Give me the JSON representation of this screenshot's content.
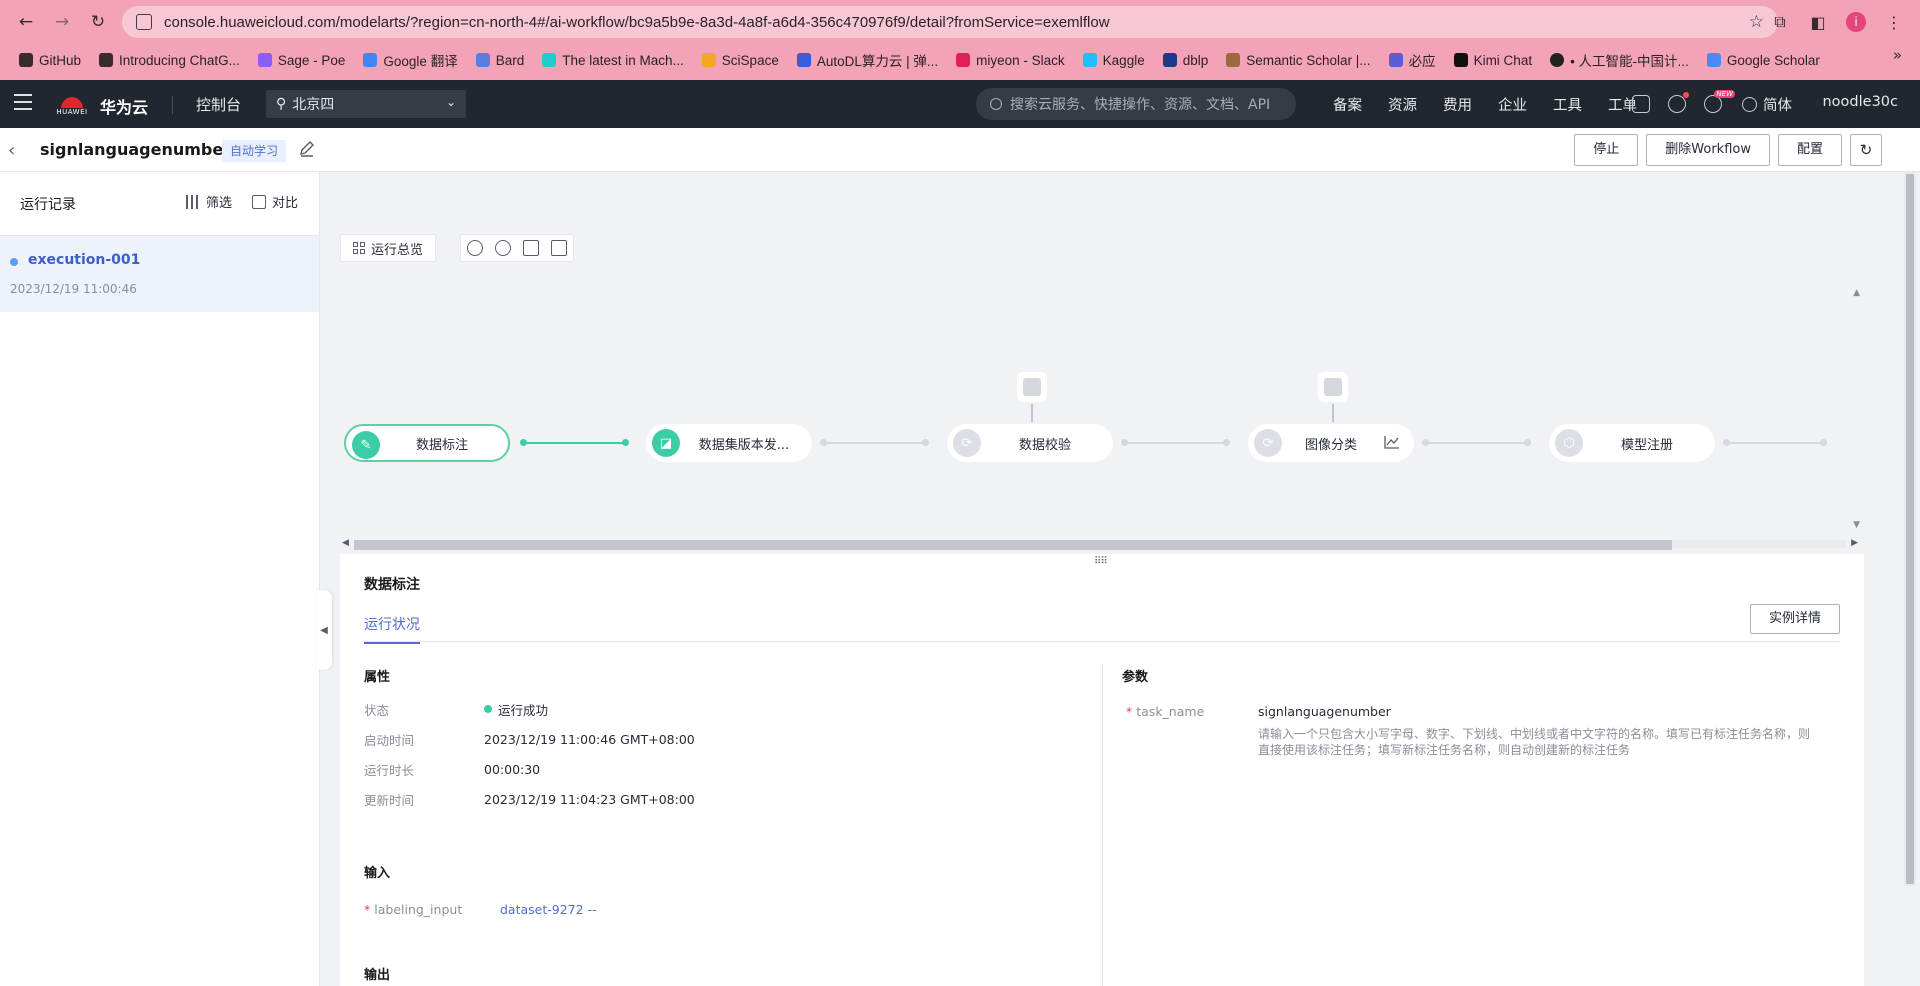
{
  "browser": {
    "url": "console.huaweicloud.com/modelarts/?region=cn-north-4#/ai-workflow/bc9a5b9e-8a3d-4a8f-a6d4-356c470976f9/detail?fromService=exemlflow",
    "profile_initial": "i",
    "bookmarks": [
      "GitHub",
      "Introducing ChatG...",
      "Sage - Poe",
      "Google 翻译",
      "Bard",
      "The latest in Mach...",
      "SciSpace",
      "AutoDL算力云 | 弹...",
      "miyeon - Slack",
      "Kaggle",
      "dblp",
      "Semantic Scholar |...",
      "必应",
      "Kimi Chat",
      "• 人工智能-中国计...",
      "Google Scholar"
    ]
  },
  "topbar": {
    "logo_text": "HUAWEI",
    "brand": "华为云",
    "console": "控制台",
    "region": "北京四",
    "search_placeholder": "搜索云服务、快捷操作、资源、文档、API",
    "links": [
      "备案",
      "资源",
      "费用",
      "企业",
      "工具",
      "工单"
    ],
    "new_badge": "NEW",
    "language": "简体",
    "user": "noodle30c"
  },
  "header": {
    "title": "signlanguagenumber",
    "tag": "自动学习",
    "buttons": {
      "stop": "停止",
      "delete": "删除Workflow",
      "config": "配置"
    }
  },
  "sidebar": {
    "title": "运行记录",
    "filter": "筛选",
    "compare": "对比",
    "runs": [
      {
        "name": "execution-001",
        "time": "2023/12/19 11:00:46"
      }
    ]
  },
  "canvas": {
    "overview": "运行总览",
    "nodes": [
      {
        "label": "数据标注",
        "status": "success"
      },
      {
        "label": "数据集版本发...",
        "status": "success"
      },
      {
        "label": "数据校验",
        "status": "pending"
      },
      {
        "label": "图像分类",
        "status": "pending"
      },
      {
        "label": "模型注册",
        "status": "pending"
      }
    ]
  },
  "panel": {
    "title": "数据标注",
    "tab": "运行状况",
    "detail_button": "实例详情",
    "attributes_title": "属性",
    "attributes": [
      {
        "key": "状态",
        "value": "运行成功"
      },
      {
        "key": "启动时间",
        "value": "2023/12/19 11:00:46 GMT+08:00"
      },
      {
        "key": "运行时长",
        "value": "00:00:30"
      },
      {
        "key": "更新时间",
        "value": "2023/12/19 11:04:23 GMT+08:00"
      }
    ],
    "params_title": "参数",
    "param": {
      "key": "task_name",
      "value": "signlanguagenumber",
      "desc": "请输入一个只包含大小写字母、数字、下划线、中划线或者中文字符的名称。填写已有标注任务名称，则直接使用该标注任务；填写新标注任务名称，则自动创建新的标注任务"
    },
    "input_title": "输入",
    "input": {
      "key": "labeling_input",
      "value": "dataset-9272 --"
    },
    "output_title": "输出"
  }
}
